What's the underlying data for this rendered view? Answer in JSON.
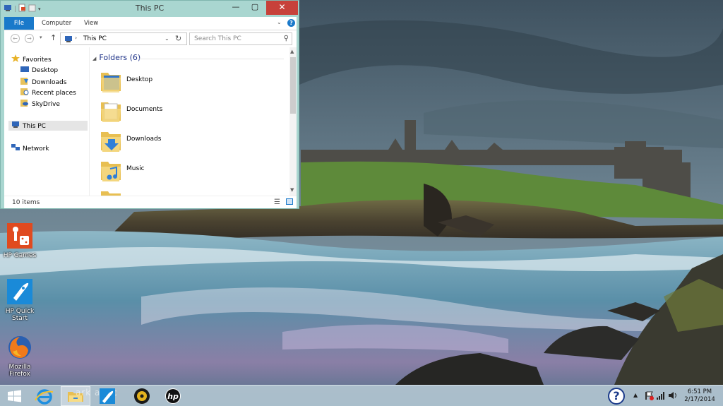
{
  "explorer": {
    "title": "This PC",
    "ribbon_tabs": [
      "File",
      "Computer",
      "View"
    ],
    "address": "This PC",
    "search_placeholder": "Search This PC",
    "nav": {
      "favorites": "Favorites",
      "favorites_items": [
        "Desktop",
        "Downloads",
        "Recent places",
        "SkyDrive"
      ],
      "this_pc": "This PC",
      "network": "Network"
    },
    "group_label": "Folders (6)",
    "folders": [
      "Desktop",
      "Documents",
      "Downloads",
      "Music"
    ],
    "status_count": "10 items"
  },
  "desktop_icons": [
    {
      "label_1": "HP Games",
      "label_2": "",
      "icon": "hp-games-icon"
    },
    {
      "label_1": "HP Quick",
      "label_2": "Start",
      "icon": "hp-quick-start-icon"
    },
    {
      "label_1": "Mozilla",
      "label_2": "Firefox",
      "icon": "firefox-icon"
    }
  ],
  "taskbar": {
    "ghost_text": "ark allac",
    "time": "6:51 PM",
    "date": "2/17/2014"
  },
  "colors": {
    "file_tab": "#1979ca",
    "close_button": "#c7413a",
    "window_frame": "#a9d6d0",
    "group_header": "#1e3287"
  }
}
